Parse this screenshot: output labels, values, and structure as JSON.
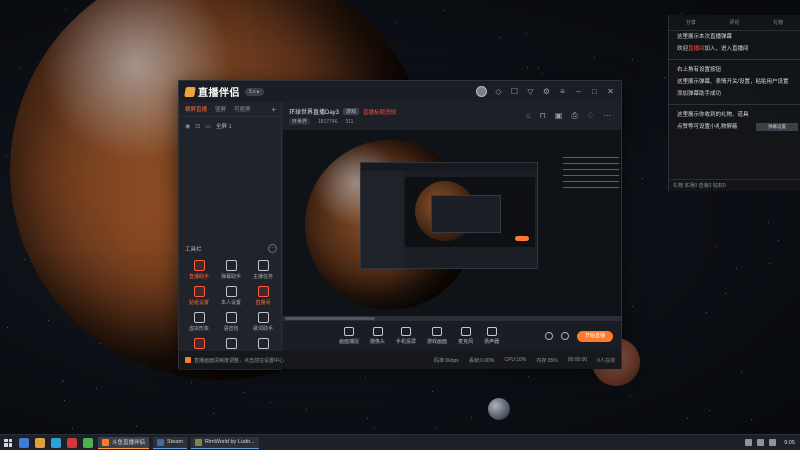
{
  "app": {
    "logo_text": "直播伴侣",
    "version": "5.x ▸",
    "title_icons": [
      "avatar",
      "diamond-icon",
      "message-icon",
      "shirt-icon",
      "settings-icon",
      "menu-icon",
      "minimize-icon",
      "maximize-icon",
      "close-icon"
    ]
  },
  "sidebar": {
    "tabs": [
      "横屏直播",
      "竖屏",
      "可居屏"
    ],
    "scene_label": "全屏 1",
    "tools_title": "工具栏",
    "tools": [
      {
        "label": "直播助手",
        "hot": true
      },
      {
        "label": "弹幕助手",
        "hot": false
      },
      {
        "label": "主播任务",
        "hot": false
      },
      {
        "label": "贴纸设置",
        "hot": true
      },
      {
        "label": "本人设置",
        "hot": false
      },
      {
        "label": "直播间",
        "hot": true
      },
      {
        "label": "虚拟形象",
        "hot": false
      },
      {
        "label": "语音包",
        "hot": false
      },
      {
        "label": "歌词助手",
        "hot": false
      },
      {
        "label": "福袋",
        "hot": true
      },
      {
        "label": "PK",
        "hot": false
      },
      {
        "label": "更多",
        "hot": false
      }
    ]
  },
  "room": {
    "title": "环球世界直播Day3",
    "tag": "游戏",
    "warn": "直播标题违规",
    "category": "环世界",
    "id_text": "1817746",
    "likes": "311"
  },
  "toolbar": {
    "buttons": [
      "画面捕捉",
      "摄像头",
      "手机投屏",
      "游戏画面",
      "麦克风",
      "扬声器"
    ],
    "go_live": "开始直播"
  },
  "status": {
    "tip": "直播画面清晰度调整，点击前往设置中心",
    "stats": [
      "码率:0kbps",
      "丢帧:0.00%",
      "CPU:10%",
      "内存:35%",
      "00:00:00",
      "0人在线"
    ]
  },
  "overlay": {
    "head": [
      "分享",
      "评论",
      "礼物"
    ],
    "lines": [
      {
        "text": "这里展示本次直播弹幕",
        "red": ""
      },
      {
        "text": "欢迎",
        "red": "直播间",
        "after": "加入，进入直播间"
      },
      {
        "text": "右上角有设置按钮",
        "red": ""
      },
      {
        "text": "这里展示弹幕、表情开关/设置，粘贴用户设置",
        "red": ""
      },
      {
        "text": "添加弹幕助手成功",
        "red": ""
      },
      {
        "text": "这里展示你收到的礼物、道具",
        "red": ""
      },
      {
        "text": "点赞等可设置小礼物屏蔽",
        "red": ""
      }
    ],
    "box_label": "弹幕设置",
    "foot": "礼物  本场0  音浪0  钻石0"
  },
  "taskbar": {
    "apps": [
      {
        "label": "斗鱼直播伴侣",
        "color": "#ff7a2a",
        "active": true
      },
      {
        "label": "Steam",
        "color": "#3a6ea8",
        "active": false
      },
      {
        "label": "RimWorld by Ludo...",
        "color": "#7a8a4a",
        "active": false
      }
    ],
    "time": "9:05"
  }
}
